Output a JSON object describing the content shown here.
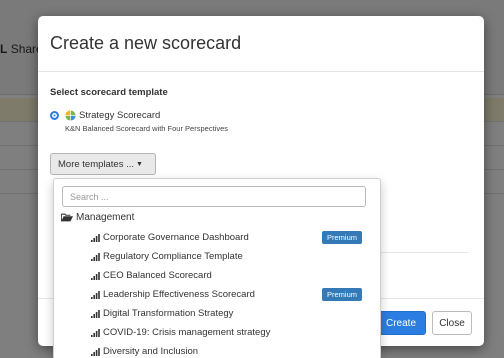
{
  "background": {
    "share_label": "Share"
  },
  "modal": {
    "title": "Create a new scorecard",
    "section_label": "Select scorecard template",
    "selected_template": {
      "name": "Strategy Scorecard",
      "description": "K&N Balanced Scorecard with Four Perspectives",
      "icon": "globe-icon"
    },
    "more_templates_label": "More templates ...",
    "footer": {
      "create_label": "Create",
      "close_label": "Close"
    },
    "colors": {
      "primary": "#2b7de1",
      "premium_badge": "#337ab7"
    }
  },
  "dropdown": {
    "search_placeholder": "Search ...",
    "group": {
      "label": "Management",
      "icon": "folder-open-icon"
    },
    "items": [
      {
        "label": "Corporate Governance Dashboard",
        "badge": "Premium"
      },
      {
        "label": "Regulatory Compliance Template",
        "badge": ""
      },
      {
        "label": "CEO Balanced Scorecard",
        "badge": ""
      },
      {
        "label": "Leadership Effectiveness Scorecard",
        "badge": "Premium"
      },
      {
        "label": "Digital Transformation Strategy",
        "badge": ""
      },
      {
        "label": "COVID-19: Crisis management strategy",
        "badge": ""
      },
      {
        "label": "Diversity and Inclusion",
        "badge": ""
      }
    ]
  }
}
